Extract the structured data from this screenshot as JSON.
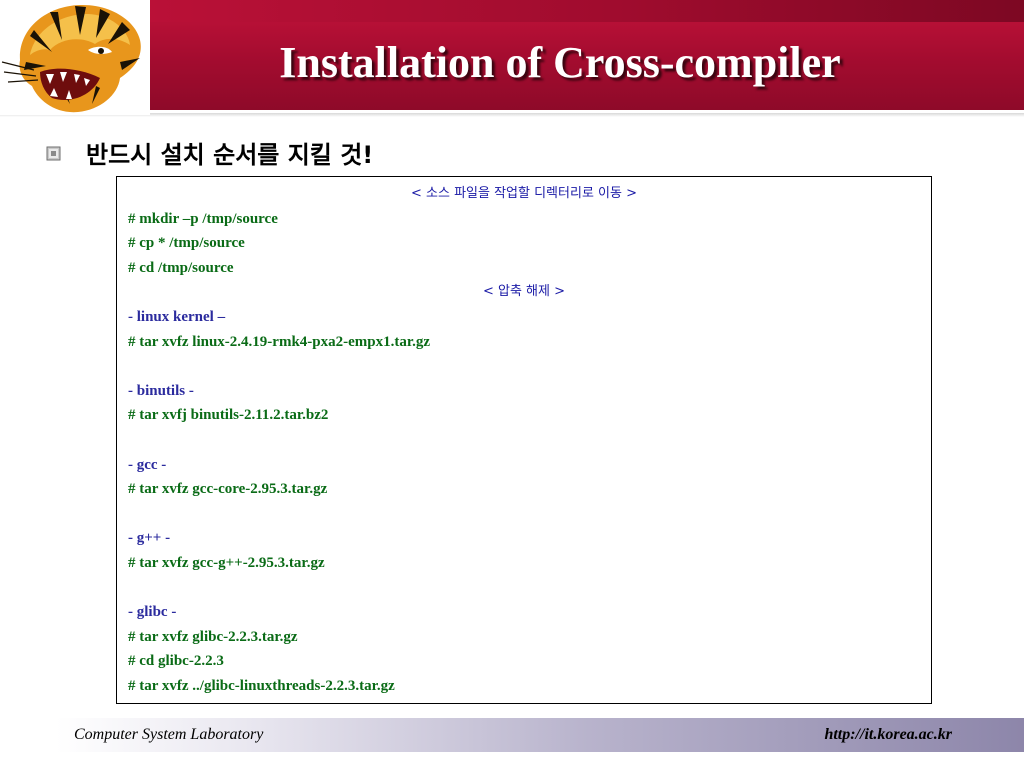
{
  "slide": {
    "title": "Installation of Cross-compiler",
    "bullet": "반드시 설치 순서를 지킬 것!"
  },
  "commands": [
    {
      "kind": "center",
      "text": "< 소스 파일을 작업할 디렉터리로 이동 >"
    },
    {
      "kind": "cmd",
      "text": "#  mkdir  –p  /tmp/source"
    },
    {
      "kind": "cmd",
      "text": "#  cp  *  /tmp/source"
    },
    {
      "kind": "cmd",
      "text": "#  cd  /tmp/source"
    },
    {
      "kind": "center",
      "text": "< 압축 해제 >"
    },
    {
      "kind": "section",
      "text": "- linux kernel –"
    },
    {
      "kind": "cmd",
      "text": "#  tar  xvfz  linux-2.4.19-rmk4-pxa2-empx1.tar.gz"
    },
    {
      "kind": "blank",
      "text": ""
    },
    {
      "kind": "section",
      "text": "- binutils -"
    },
    {
      "kind": "cmd",
      "text": "#  tar  xvfj  binutils-2.11.2.tar.bz2"
    },
    {
      "kind": "blank",
      "text": ""
    },
    {
      "kind": "section",
      "text": "- gcc -"
    },
    {
      "kind": "cmd",
      "text": "#  tar  xvfz  gcc-core-2.95.3.tar.gz"
    },
    {
      "kind": "blank",
      "text": ""
    },
    {
      "kind": "section",
      "text": "- g++ -"
    },
    {
      "kind": "cmd",
      "text": "#  tar  xvfz  gcc-g++-2.95.3.tar.gz"
    },
    {
      "kind": "blank",
      "text": ""
    },
    {
      "kind": "section",
      "text": "- glibc -"
    },
    {
      "kind": "cmd",
      "text": "#  tar  xvfz  glibc-2.2.3.tar.gz"
    },
    {
      "kind": "cmd",
      "text": "#  cd  glibc-2.2.3"
    },
    {
      "kind": "cmd",
      "text": "#  tar  xvfz  ../glibc-linuxthreads-2.2.3.tar.gz"
    }
  ],
  "footer": {
    "left": "Computer System Laboratory",
    "right": "http://it.korea.ac.kr"
  },
  "icons": {
    "logo": "tiger-head-logo",
    "bullet": "bullet-square-icon"
  },
  "colors": {
    "header": "#a30c2f",
    "command_text": "#0a6b16",
    "section_text": "#2b2b9e",
    "heading_text": "#1a1aa6"
  }
}
